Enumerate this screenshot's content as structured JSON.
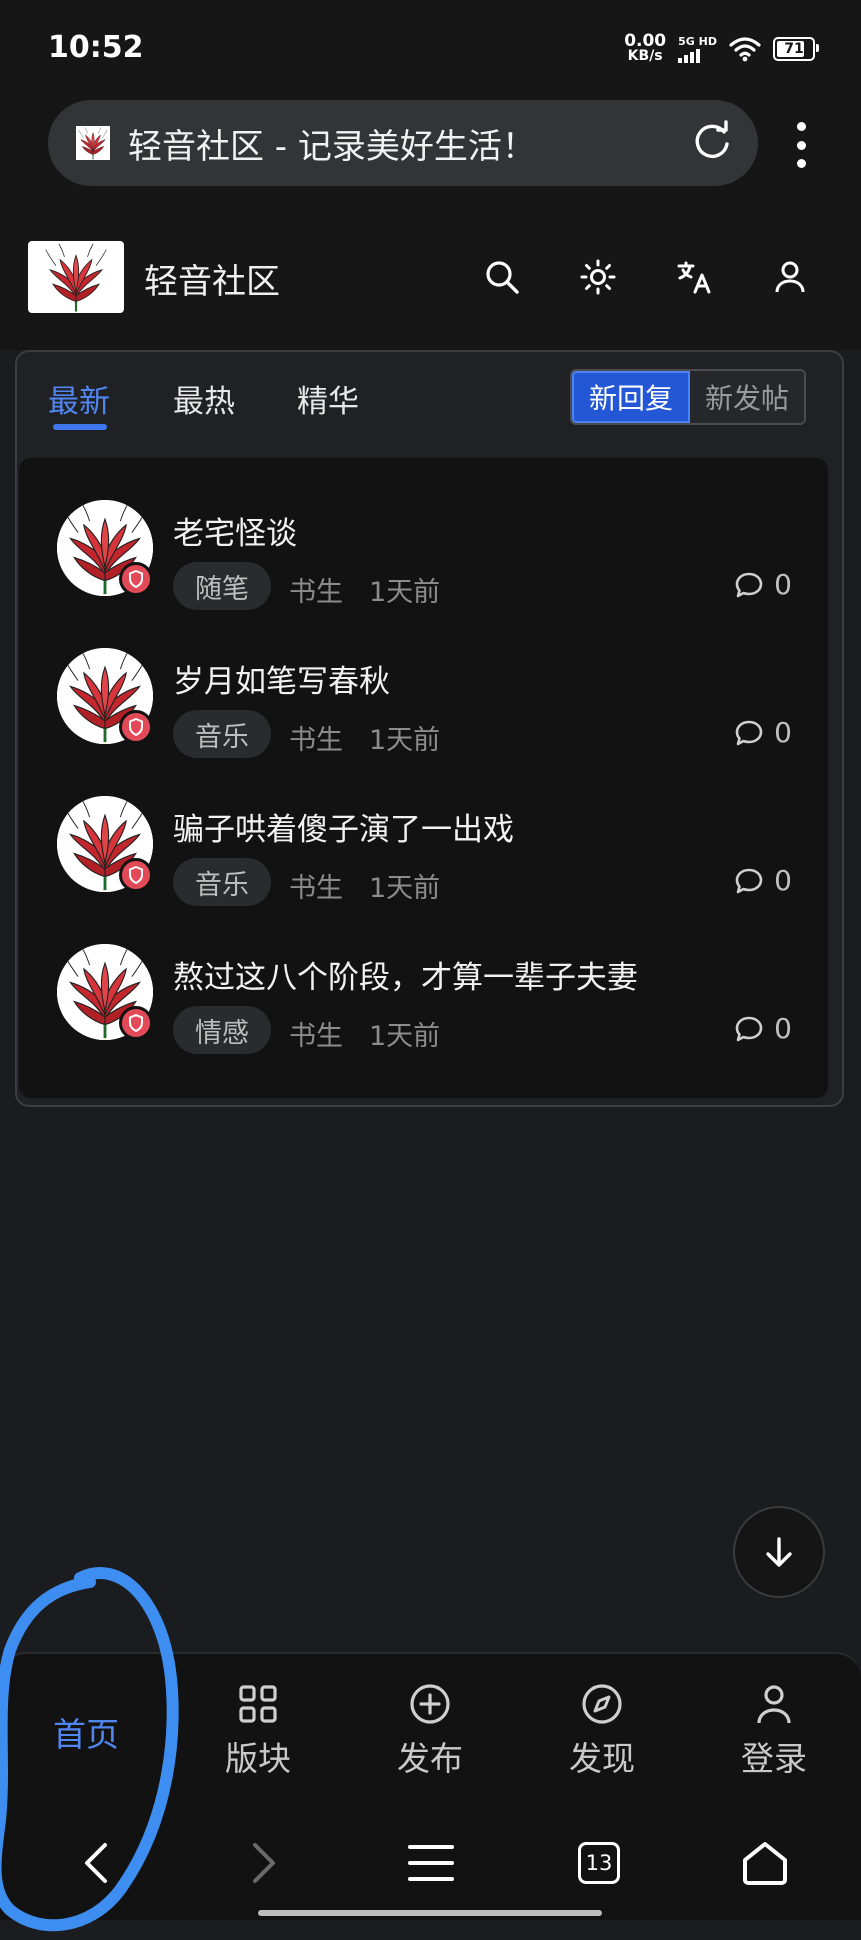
{
  "status_bar": {
    "time": "10:52",
    "net_speed_value": "0.00",
    "net_speed_unit": "KB/s",
    "network_label": "5G HD",
    "battery_level": "71"
  },
  "url_bar": {
    "page_title": "轻音社区 - 记录美好生活！"
  },
  "site_header": {
    "site_name": "轻音社区"
  },
  "tabs": [
    {
      "label": "最新",
      "active": true
    },
    {
      "label": "最热",
      "active": false
    },
    {
      "label": "精华",
      "active": false
    }
  ],
  "sort_toggle": {
    "options": [
      "新回复",
      "新发帖"
    ],
    "selected": "新回复"
  },
  "posts": [
    {
      "title": "老宅怪谈",
      "tag": "随笔",
      "author": "书生",
      "time": "1天前",
      "comments": "0"
    },
    {
      "title": "岁月如笔写春秋",
      "tag": "音乐",
      "author": "书生",
      "time": "1天前",
      "comments": "0"
    },
    {
      "title": "骗子哄着傻子演了一出戏",
      "tag": "音乐",
      "author": "书生",
      "time": "1天前",
      "comments": "0"
    },
    {
      "title": "熬过这八个阶段，才算一辈子夫妻",
      "tag": "情感",
      "author": "书生",
      "time": "1天前",
      "comments": "0"
    }
  ],
  "bottom_nav": [
    {
      "label": "首页",
      "icon": "home",
      "active": true
    },
    {
      "label": "版块",
      "icon": "grid-icon",
      "active": false
    },
    {
      "label": "发布",
      "icon": "plus-circle-icon",
      "active": false
    },
    {
      "label": "发现",
      "icon": "compass-icon",
      "active": false
    },
    {
      "label": "登录",
      "icon": "user-icon",
      "active": false
    }
  ],
  "browser_bar": {
    "tab_count": "13"
  },
  "colors": {
    "accent": "#4f86f0",
    "badge_red": "#e24a58",
    "annotation_blue": "#3d8ef0"
  }
}
